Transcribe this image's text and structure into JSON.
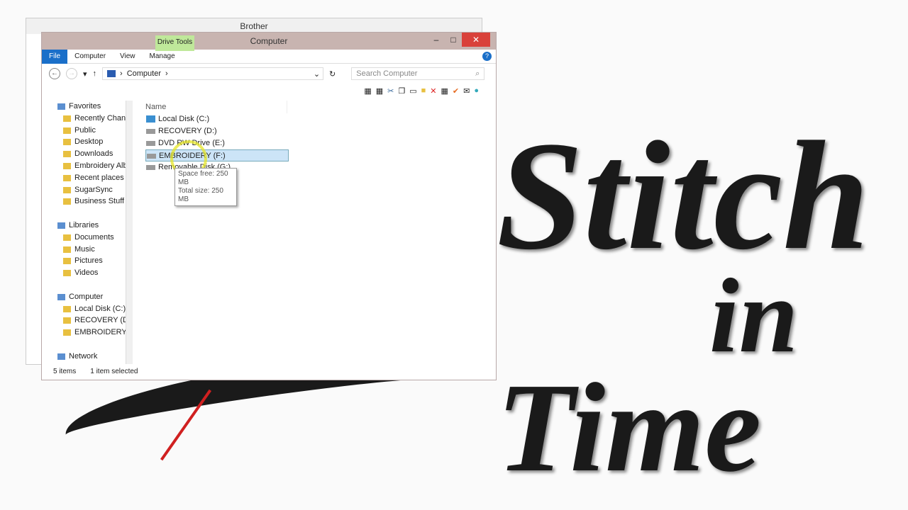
{
  "background_logo": {
    "line1": "Stitch",
    "line2": "in",
    "line3": "Time"
  },
  "back_window": {
    "title": "Brother"
  },
  "window": {
    "title": "Computer",
    "context_tab": "Drive Tools",
    "minimize": "–",
    "maximize": "□",
    "close": "✕"
  },
  "ribbon": {
    "tabs": [
      "File",
      "Computer",
      "View",
      "Manage"
    ],
    "expand": "⌄",
    "help": "?"
  },
  "address": {
    "back": "←",
    "forward": "→",
    "recent": "▾",
    "up": "↑",
    "path": "Computer",
    "sep": "›",
    "dropdown": "⌄",
    "refresh": "↻",
    "search_placeholder": "Search Computer",
    "search_icon": "⌕"
  },
  "toolbar_icons": [
    "properties",
    "properties",
    "cut",
    "copy",
    "paste",
    "new-folder",
    "delete",
    "rename",
    "check",
    "mail",
    "globe"
  ],
  "nav": {
    "groups": [
      {
        "label": "Favorites",
        "items": [
          "Recently Changed",
          "Public",
          "Desktop",
          "Downloads",
          "Embroidery Album",
          "Recent places",
          "SugarSync",
          "Business Stuff"
        ]
      },
      {
        "label": "Libraries",
        "items": [
          "Documents",
          "Music",
          "Pictures",
          "Videos"
        ]
      },
      {
        "label": "Computer",
        "items": [
          "Local Disk (C:)",
          "RECOVERY (D:)",
          "EMBROIDERY (F:)"
        ]
      },
      {
        "label": "Network",
        "items": []
      }
    ]
  },
  "list": {
    "column": "Name",
    "items": [
      "Local Disk (C:)",
      "RECOVERY (D:)",
      "DVD RW Drive (E:)",
      "EMBROIDERY (F:)",
      "Removable Disk (G:)"
    ],
    "selected_index": 3
  },
  "tooltip": {
    "line1": "Space free: 250 MB",
    "line2": "Total size: 250 MB"
  },
  "status": {
    "count": "5 items",
    "selected": "1 item selected"
  },
  "colors": {
    "accent": "#1a6fc9",
    "close": "#d9413a",
    "selection": "#cce4f7",
    "drive_tools": "#bfe89a"
  }
}
